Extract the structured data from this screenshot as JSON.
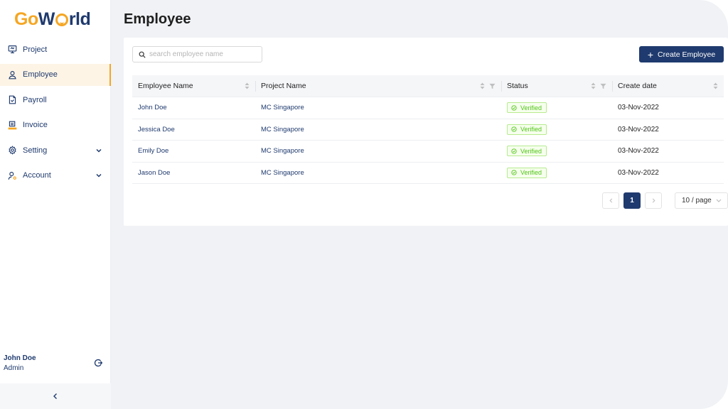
{
  "brand": {
    "logo_go": "Go",
    "logo_w": "W",
    "logo_rld": "rld"
  },
  "sidebar": {
    "items": [
      {
        "label": "Project",
        "icon": "monitor-icon",
        "active": false,
        "expandable": false
      },
      {
        "label": "Employee",
        "icon": "person-icon",
        "active": true,
        "expandable": false
      },
      {
        "label": "Payroll",
        "icon": "document-icon",
        "active": false,
        "expandable": false
      },
      {
        "label": "Invoice",
        "icon": "invoice-icon",
        "active": false,
        "expandable": false
      },
      {
        "label": "Setting",
        "icon": "gear-icon",
        "active": false,
        "expandable": true
      },
      {
        "label": "Account",
        "icon": "user-gear-icon",
        "active": false,
        "expandable": true
      }
    ],
    "user": {
      "name": "John Doe",
      "role": "Admin"
    }
  },
  "main": {
    "title": "Employee",
    "search": {
      "placeholder": "search employee name",
      "value": ""
    },
    "create_button": "Create Employee",
    "table": {
      "columns": [
        "Employee Name",
        "Project Name",
        "Status",
        "Create date"
      ],
      "rows": [
        {
          "name": "John Doe",
          "project": "MC Singapore",
          "status": "Verified",
          "date": "03-Nov-2022"
        },
        {
          "name": "Jessica Doe",
          "project": "MC Singapore",
          "status": "Verified",
          "date": "03-Nov-2022"
        },
        {
          "name": "Emily Doe",
          "project": "MC Singapore",
          "status": "Verified",
          "date": "03-Nov-2022"
        },
        {
          "name": "Jason Doe",
          "project": "MC Singapore",
          "status": "Verified",
          "date": "03-Nov-2022"
        }
      ]
    },
    "pagination": {
      "current_page": "1",
      "page_size": "10 / page"
    }
  },
  "colors": {
    "brand_navy": "#1f3a6e",
    "brand_orange": "#f5a623",
    "status_green": "#52c41a"
  }
}
